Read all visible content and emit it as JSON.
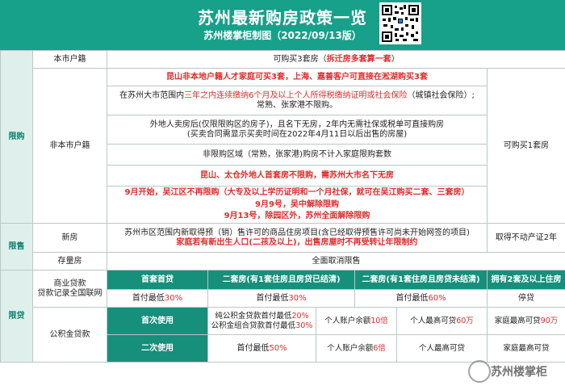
{
  "header": {
    "title": "苏州最新购房政策一览",
    "subtitle": "苏州楼掌柜制图（2022/09/13版）"
  },
  "sections": {
    "xiangou": "限购",
    "xianshou": "限售",
    "xiandai": "限贷"
  },
  "xiangou": {
    "local_label": "本市户籍",
    "local_value_plain": "可购买3套房（",
    "local_value_red": "拆迁房多套算一套",
    "local_value_tail": "）",
    "nonlocal_label": "非本市户籍",
    "rows": {
      "r1": "昆山非本地户籍人才家庭可买3套，上海、嘉善客户可直接在淞湖购买3套",
      "r2_pre": "在苏州大市范围内",
      "r2_red": "三年之内连续缴纳6个月及以上个人所得税缴纳证明或社会保险",
      "r2_post": "（城镇社会保险）;",
      "r2_line2": "常熟、张家港不限购。",
      "r3_line1": "外地人卖房后(仅限限购区的房子)，且名下无房，2年内无需社保或税单可直接购房",
      "r3_line2": "(买卖合同需显示买卖时间在2022年4月11日以后出售的房屋)",
      "r4": "非限购区域（常熟，张家港)购房不计入家庭限购套数",
      "r5": "昆山、太仓外地人首套房不限购，需苏州大市名下无房",
      "r6_line1": "9月开始，吴江区不再限购（大专及以上学历证明和一个月社保，就可在吴江购买二套、三套房）",
      "r6_line2": "9月9号，吴中解除限购",
      "r6_line3": "9月13号，除园区外，苏州全面解除限购"
    },
    "right_note": "可购买1套房"
  },
  "xianshou": {
    "new_label": "新房",
    "new_line1": "苏州市区范围内新取得预（销）售许可的商品住房项目(含已经取得预售许可尚未开始网签的项目)",
    "new_line2": "家庭若有新出生人口(二孩及以上)，出售房屋时不再受转让年限制约",
    "new_right": "取得不动产证2年",
    "stock_label": "存量房",
    "stock_value": "全面取消限售"
  },
  "xiandai": {
    "commercial_label_1": "商业贷款",
    "commercial_label_2": "贷款记录全国联网",
    "headers": {
      "h1": "首套首贷",
      "h2": "二套房(有1套住房且房贷已结清)",
      "h3": "二套房(有1套住房且房贷未结清)",
      "h4": "拥有2套及以上住房"
    },
    "commercial": {
      "c1_pre": "首付最低",
      "c1_val": "30%",
      "c2_pre": "首付最低",
      "c2_val": "30%",
      "c3_pre": "首付最低",
      "c3_val": "60%",
      "c4": "停贷"
    },
    "fund_label": "公积金贷款",
    "fund": {
      "first_use": "首次使用",
      "first_a_pre": "纯公积金贷款首付最低",
      "first_a_val": "20%",
      "first_b_pre": "公积金组合贷款首付最低",
      "first_b_val": "30%",
      "first_c_pre": "个人账户余额",
      "first_c_val": "10倍",
      "first_d_pre": "个人最高可贷",
      "first_d_val": "60万",
      "first_e_pre": "家庭最高可贷",
      "first_e_val": "90万",
      "second_use": "二次使用",
      "second_a_pre": "首付最低",
      "second_a_val": "50%",
      "second_c_pre": "个人账户余额",
      "second_c_val": "6倍",
      "second_d_pre": "个人最高可贷",
      "second_d_val": "",
      "second_e_pre": "家庭最高可贷",
      "second_e_val": ""
    }
  },
  "watermark": "苏州楼掌柜",
  "colors": {
    "header_bg": "#17a08a",
    "accent": "#168f7b",
    "highlight_red": "#e02c2c"
  }
}
